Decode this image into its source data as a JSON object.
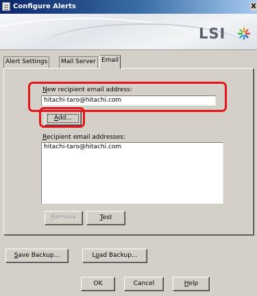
{
  "window": {
    "title": "Configure Alerts",
    "close_label": "X"
  },
  "banner": {
    "brand": "LSI"
  },
  "tabs": [
    {
      "label": "Alert Settings",
      "active": false
    },
    {
      "label": "Mail Server",
      "active": false
    },
    {
      "label": "Email",
      "active": true
    }
  ],
  "email_tab": {
    "new_recipient_label_mnemonic": "N",
    "new_recipient_label_rest": "ew recipient email address:",
    "new_recipient_value": "hitachi-taro@hitachi.com",
    "add_button_mnemonic": "A",
    "add_button_rest": "dd...",
    "recipients_label_mnemonic": "R",
    "recipients_label_rest": "ecipient email addresses:",
    "recipients": [
      "hitachi-taro@hitachi.com"
    ],
    "remove_button_mnemonic": "R",
    "remove_button_rest": "emove",
    "test_button_mnemonic": "T",
    "test_button_rest": "est"
  },
  "footer": {
    "save_backup_mnemonic": "S",
    "save_backup_rest": "ave Backup...",
    "load_backup_prefix": "L",
    "load_backup_mnemonic": "o",
    "load_backup_rest": "ad Backup...",
    "ok_label": "OK",
    "cancel_label": "Cancel",
    "help_mnemonic": "H",
    "help_rest": "elp"
  },
  "colors": {
    "highlight": "#e4141a",
    "title_bar": "#0a246a"
  }
}
